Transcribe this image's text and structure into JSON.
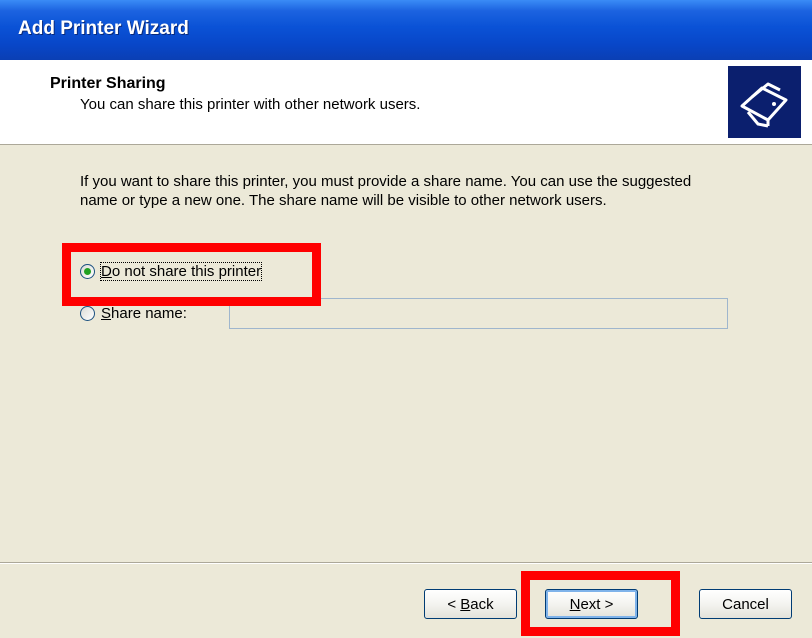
{
  "window": {
    "title": "Add Printer Wizard"
  },
  "header": {
    "title": "Printer Sharing",
    "subtitle": "You can share this printer with other network users.",
    "icon": "printer-share-icon"
  },
  "body": {
    "description": "If you want to share this printer, you must provide a share name. You can use the suggested name or type a new one. The share name will be visible to other network users.",
    "options": [
      {
        "label_prefix": "",
        "label_key": "D",
        "label_rest": "o not share this printer",
        "checked": true
      },
      {
        "label_prefix": "",
        "label_key": "S",
        "label_rest": "hare name:",
        "checked": false
      }
    ],
    "share_name_value": ""
  },
  "buttons": {
    "back_prefix": "< ",
    "back_key": "B",
    "back_rest": "ack",
    "next_key": "N",
    "next_rest": "ext >",
    "cancel": "Cancel"
  },
  "colors": {
    "highlight": "#ff0000",
    "titlebar": "#0a52d6",
    "accent_radio": "#21a121"
  }
}
